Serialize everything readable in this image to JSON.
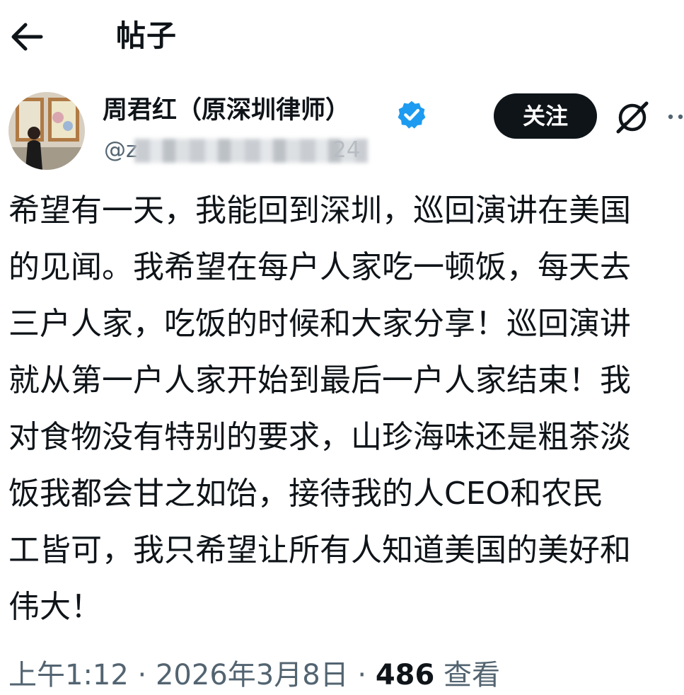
{
  "header": {
    "title": "帖子"
  },
  "author": {
    "display_name": "周君红（原深圳律师）",
    "handle_visible_prefix": "@z",
    "handle_visible_suffix": "24",
    "verified": true
  },
  "actions": {
    "follow_label": "关注"
  },
  "post": {
    "text": "希望有一天，我能回到深圳，巡回演讲在美国\n的见闻。我希望在每户人家吃一顿饭，每天去\n三户人家，吃饭的时候和大家分享！巡回演讲\n就从第一户人家开始到最后一户人家结束！我\n对食物没有特别的要求，山珍海味还是粗茶淡\n饭我都会甘之如饴，接待我的人CEO和农民\n工皆可，我只希望让所有人知道美国的美好和\n伟大！",
    "time": "上午1:12 · 2026年3月8日 · ",
    "views": "486",
    "views_label": " 查看"
  },
  "colors": {
    "accent": "#0f1419",
    "verified": "#1d9bf0",
    "muted": "#536471"
  },
  "icons": [
    "back-arrow-icon",
    "verified-badge-icon",
    "grok-icon",
    "more-icon"
  ]
}
